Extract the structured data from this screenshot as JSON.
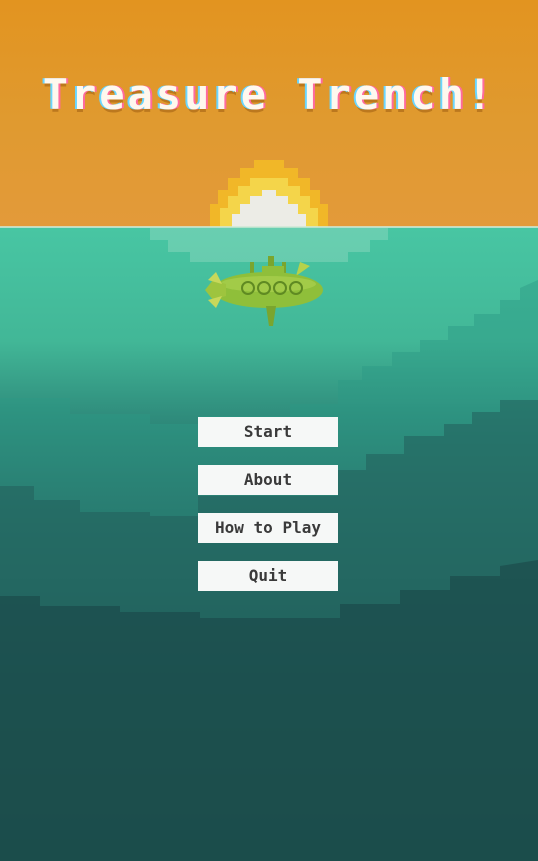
{
  "title": "Treasure Trench!",
  "menu": {
    "start_label": "Start",
    "about_label": "About",
    "how_to_play_label": "How to Play",
    "quit_label": "Quit"
  },
  "colors": {
    "sky": "#e29420",
    "sun_outer": "#f2c230",
    "sun_inner": "#f7e86a",
    "sun_core": "#efefef",
    "sea_surface": "#48c6a3",
    "sea_deep": "#0a191a",
    "submarine": "#8fbf3a",
    "button_bg": "#f6f8f7",
    "button_text": "#3a3a3a"
  },
  "icons": {
    "submarine": "submarine-icon",
    "sun": "sun-icon"
  }
}
